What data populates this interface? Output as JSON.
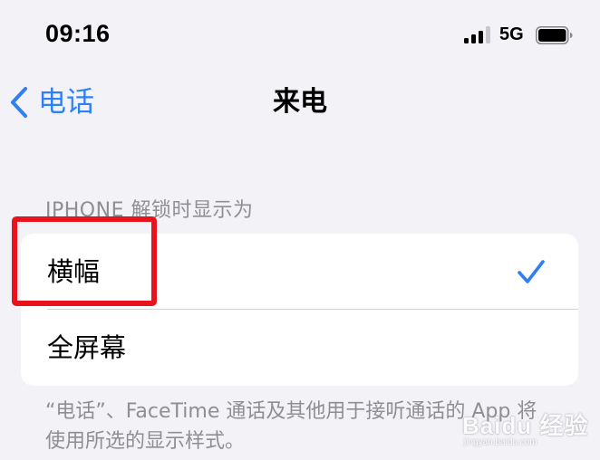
{
  "status_bar": {
    "time": "09:16",
    "network": "5G",
    "signal_bars_active": 3,
    "signal_bars_total": 4,
    "battery_level": 0.85
  },
  "nav": {
    "back_label": "电话",
    "title": "来电"
  },
  "section": {
    "header": "IPHONE 解锁时显示为",
    "options": [
      {
        "label": "横幅",
        "selected": true
      },
      {
        "label": "全屏幕",
        "selected": false
      }
    ]
  },
  "footer": {
    "text": "“电话”、FaceTime 通话及其他用于接听通话的 App 将使用所选的显示样式。"
  },
  "watermark": {
    "text": "Baidu 经验",
    "sub": "jingyan.baidu.com"
  },
  "colors": {
    "accent": "#2f7ff5",
    "highlight": "#e8131c",
    "background": "#f2f2f7",
    "secondary_text": "#8e8e93"
  },
  "icons": {
    "back": "chevron-left-icon",
    "check": "checkmark-icon",
    "signal": "cellular-signal-icon",
    "battery": "battery-icon"
  }
}
